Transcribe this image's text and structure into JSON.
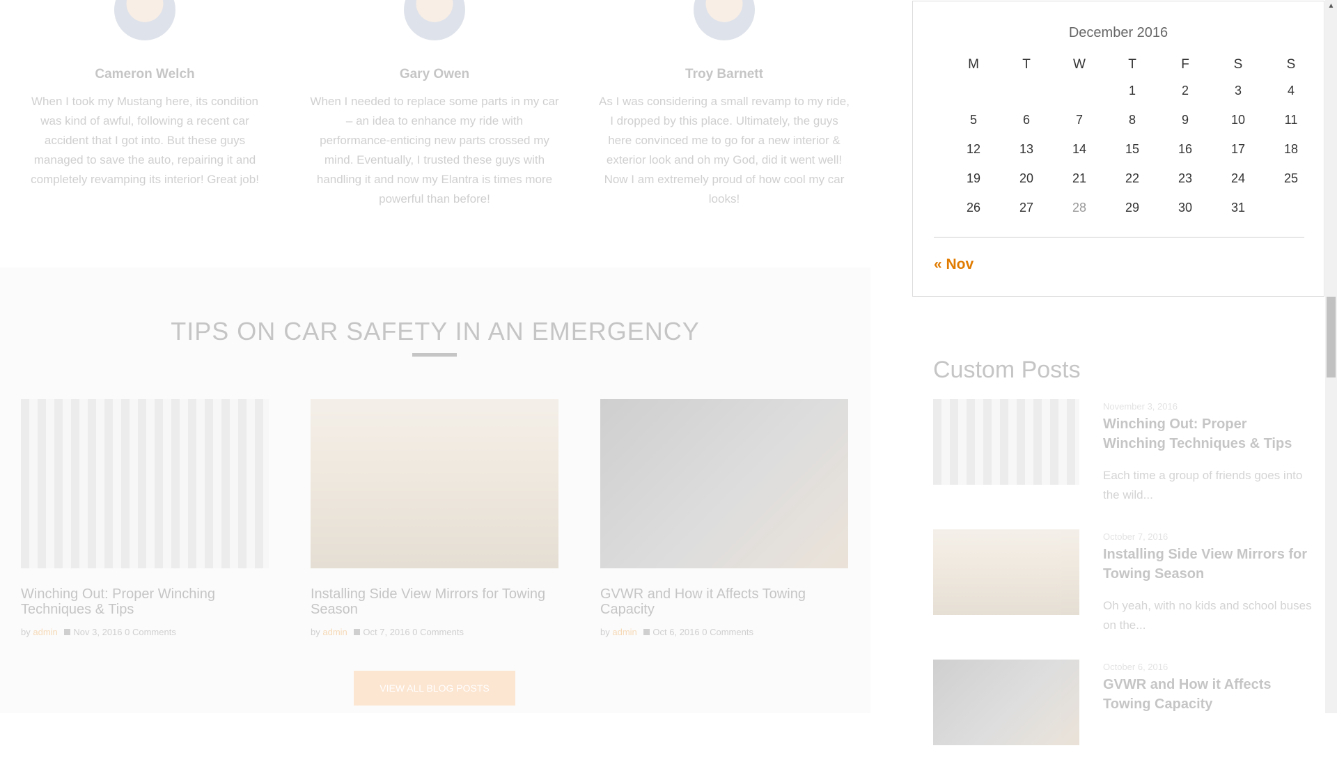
{
  "testimonials": [
    {
      "name": "Cameron Welch",
      "quote": "When I took my Mustang here, its condition was kind of awful, following a recent car accident that I got into. But these guys managed to save the auto, repairing it and completely revamping its interior! Great job!"
    },
    {
      "name": "Gary Owen",
      "quote": "When I needed to replace some parts in my car – an idea to enhance my ride with performance-enticing new parts crossed my mind. Eventually, I trusted these guys with handling it and now my Elantra is times more powerful than before!"
    },
    {
      "name": "Troy Barnett",
      "quote": "As I was considering a small revamp to my ride, I dropped by this place. Ultimately, the guys here convinced me to go for a new interior & exterior look and oh my God, did it went well! Now I am extremely proud of how cool my car looks!"
    }
  ],
  "blog": {
    "title": "TIPS ON CAR SAFETY IN AN EMERGENCY",
    "cta": "VIEW ALL BLOG POSTS",
    "posts": [
      {
        "title": "Winching Out: Proper Winching Techniques & Tips",
        "by": "by",
        "author": "admin",
        "date": "Nov 3, 2016",
        "comments": "0 Comments"
      },
      {
        "title": "Installing Side View Mirrors for Towing Season",
        "by": "by",
        "author": "admin",
        "date": "Oct 7, 2016",
        "comments": "0 Comments"
      },
      {
        "title": "GVWR and How it Affects Towing Capacity",
        "by": "by",
        "author": "admin",
        "date": "Oct 6, 2016",
        "comments": "0 Comments"
      }
    ]
  },
  "calendar": {
    "caption": "December 2016",
    "days": [
      "M",
      "T",
      "W",
      "T",
      "F",
      "S",
      "S"
    ],
    "weeks": [
      [
        "",
        "",
        "",
        "1",
        "2",
        "3",
        "4"
      ],
      [
        "5",
        "6",
        "7",
        "8",
        "9",
        "10",
        "11"
      ],
      [
        "12",
        "13",
        "14",
        "15",
        "16",
        "17",
        "18"
      ],
      [
        "19",
        "20",
        "21",
        "22",
        "23",
        "24",
        "25"
      ],
      [
        "26",
        "27",
        "28",
        "29",
        "30",
        "31",
        ""
      ]
    ],
    "today": "28",
    "prev": "« Nov"
  },
  "custom_posts": {
    "title": "Custom Posts",
    "items": [
      {
        "date": "November 3, 2016",
        "title": "Winching Out: Proper Winching Techniques & Tips",
        "excerpt": "Each time a group of friends goes into the wild..."
      },
      {
        "date": "October 7, 2016",
        "title": "Installing Side View Mirrors for Towing Season",
        "excerpt": "Oh yeah, with no kids and school buses on the..."
      },
      {
        "date": "October 6, 2016",
        "title": "GVWR and How it Affects Towing Capacity",
        "excerpt": ""
      }
    ]
  },
  "colors": {
    "accent": "#e07b00",
    "cta": "#f7a35c"
  }
}
